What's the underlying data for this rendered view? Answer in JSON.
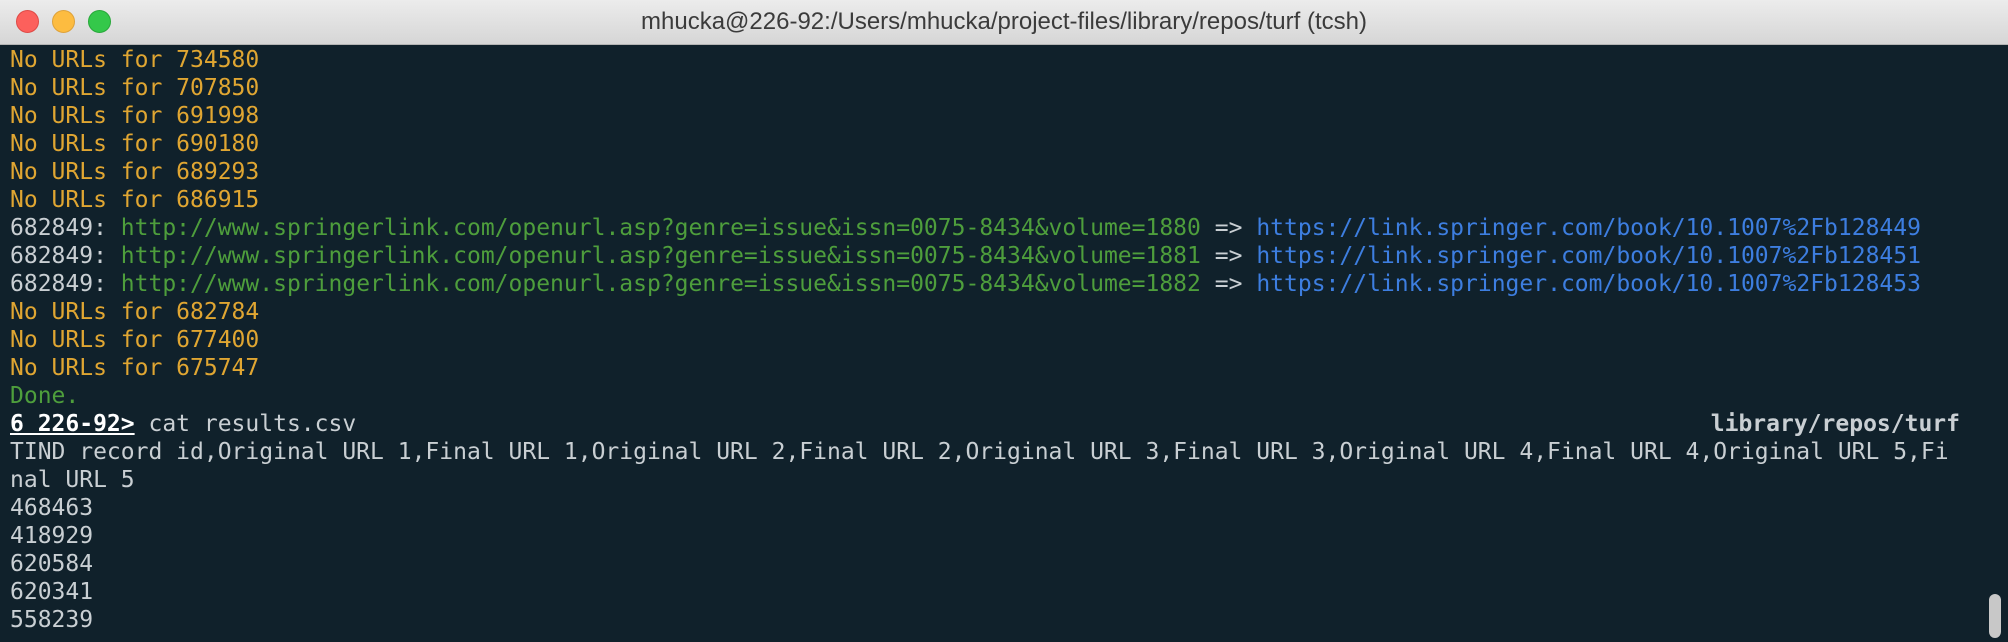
{
  "window": {
    "title": "mhucka@226-92:/Users/mhucka/project-files/library/repos/turf (tcsh)"
  },
  "terminal": {
    "no_url_lines_top": [
      "No URLs for 734580",
      "No URLs for 707850",
      "No URLs for 691998",
      "No URLs for 690180",
      "No URLs for 689293",
      "No URLs for 686915"
    ],
    "url_lines": [
      {
        "id": "682849:",
        "original": "http://www.springerlink.com/openurl.asp?genre=issue&issn=0075-8434&volume=1880",
        "arrow": "=>",
        "final": "https://link.springer.com/book/10.1007%2Fb128449"
      },
      {
        "id": "682849:",
        "original": "http://www.springerlink.com/openurl.asp?genre=issue&issn=0075-8434&volume=1881",
        "arrow": "=>",
        "final": "https://link.springer.com/book/10.1007%2Fb128451"
      },
      {
        "id": "682849:",
        "original": "http://www.springerlink.com/openurl.asp?genre=issue&issn=0075-8434&volume=1882",
        "arrow": "=>",
        "final": "https://link.springer.com/book/10.1007%2Fb128453"
      }
    ],
    "no_url_lines_bottom": [
      "No URLs for 682784",
      "No URLs for 677400",
      "No URLs for 675747"
    ],
    "done": "Done.",
    "prompt": {
      "number": "6 226-92>",
      "command": " cat results.csv",
      "right_path": "library/repos/turf"
    },
    "csv_header_line1": "TIND record id,Original URL 1,Final URL 1,Original URL 2,Final URL 2,Original URL 3,Final URL 3,Original URL 4,Final URL 4,Original URL 5,Fi",
    "csv_header_line2": "nal URL 5",
    "csv_rows": [
      "468463",
      "418929",
      "620584",
      "620341",
      "558239"
    ]
  },
  "colors": {
    "background": "#10212b",
    "warning": "#e0a632",
    "original_url": "#4e9e3c",
    "final_url": "#3d7ee0",
    "text": "#c9cfd3"
  }
}
